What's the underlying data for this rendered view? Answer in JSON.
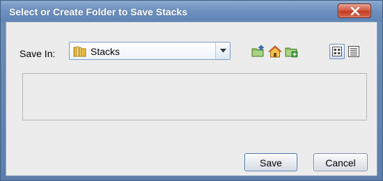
{
  "dialog": {
    "title": "Select or Create Folder to Save Stacks",
    "close_icon": "close-icon"
  },
  "save_in": {
    "label": "Save In:",
    "selected_folder": "Stacks",
    "folder_icon": "folder-icon",
    "dropdown_icon": "chevron-down-icon"
  },
  "toolbar": {
    "icons": [
      "up-one-level-icon",
      "home-icon",
      "new-folder-icon",
      "icon-view-icon",
      "list-view-icon"
    ]
  },
  "buttons": {
    "save": "Save",
    "cancel": "Cancel"
  },
  "colors": {
    "titlebar": "#6f92bf",
    "close_button": "#c03b22",
    "client_background": "#ececec"
  }
}
